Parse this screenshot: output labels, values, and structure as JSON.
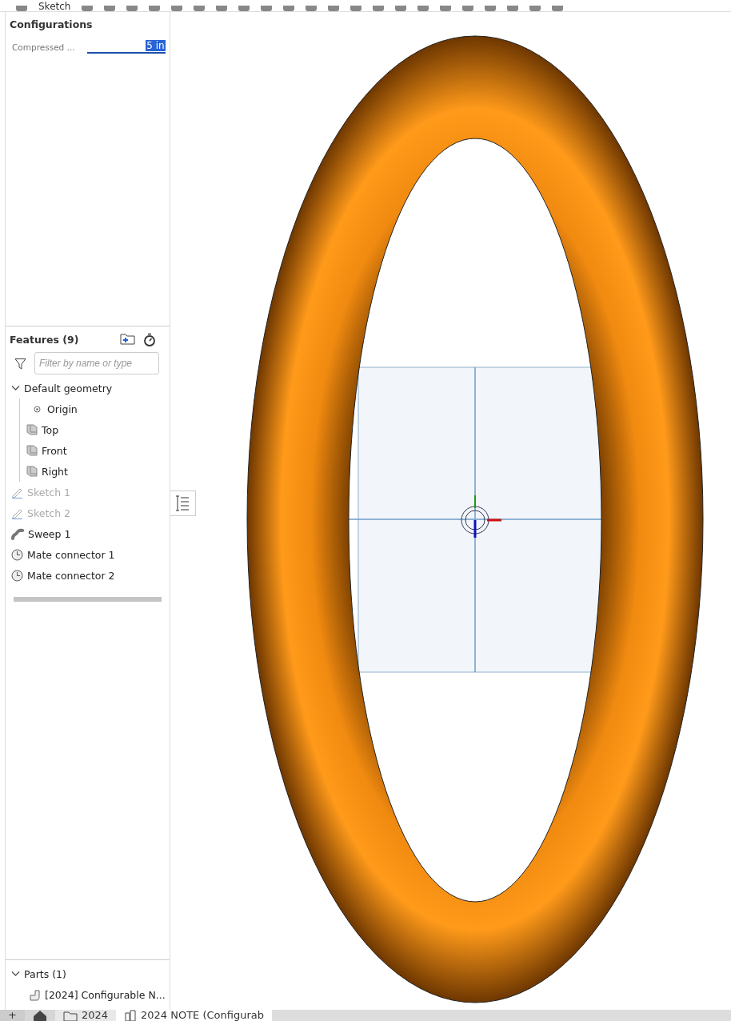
{
  "toolbar": {
    "sketch_label": "Sketch"
  },
  "configurations": {
    "title": "Configurations",
    "fields": [
      {
        "label": "Compressed ...",
        "value": "5 in",
        "selected": true
      }
    ]
  },
  "features": {
    "title": "Features (9)",
    "filter": {
      "placeholder": "Filter by name or type"
    },
    "items": [
      {
        "kind": "group",
        "label": "Default geometry",
        "expanded": true,
        "disabled": false,
        "children": [
          {
            "kind": "origin",
            "label": "Origin",
            "disabled": false
          },
          {
            "kind": "plane",
            "label": "Top",
            "disabled": false
          },
          {
            "kind": "plane",
            "label": "Front",
            "disabled": false
          },
          {
            "kind": "plane",
            "label": "Right",
            "disabled": false
          }
        ]
      },
      {
        "kind": "sketch",
        "label": "Sketch 1",
        "disabled": true
      },
      {
        "kind": "sketch",
        "label": "Sketch 2",
        "disabled": true
      },
      {
        "kind": "sweep",
        "label": "Sweep 1",
        "disabled": false
      },
      {
        "kind": "mate",
        "label": "Mate connector 1",
        "disabled": false
      },
      {
        "kind": "mate",
        "label": "Mate connector 2",
        "disabled": false
      }
    ]
  },
  "parts": {
    "title": "Parts (1)",
    "expanded": true,
    "items": [
      "[2024] Configurable N..."
    ]
  },
  "tabs": [
    {
      "kind": "add",
      "label": "+"
    },
    {
      "kind": "home"
    },
    {
      "kind": "folder",
      "label": "2024"
    },
    {
      "kind": "document",
      "label": "2024 NOTE (Configurab"
    }
  ]
}
